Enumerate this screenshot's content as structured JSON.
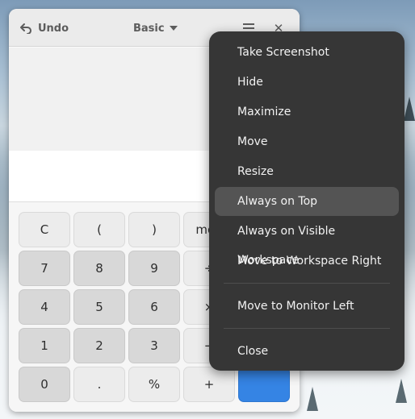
{
  "calculator": {
    "undo_label": "Undo",
    "mode_label": "Basic",
    "icons": {
      "undo": "undo-arrow-icon",
      "mode": "chevron-down-icon",
      "menu": "hamburger-menu-icon",
      "close": "close-icon"
    },
    "keypad": {
      "row1": [
        "C",
        "(",
        ")",
        "mod"
      ],
      "row2": [
        "7",
        "8",
        "9",
        "÷"
      ],
      "row3": [
        "4",
        "5",
        "6",
        "×"
      ],
      "row4": [
        "1",
        "2",
        "3",
        "−"
      ],
      "row5": [
        "0",
        ".",
        "%",
        "+"
      ]
    },
    "colors": {
      "accent": "#3584e4"
    }
  },
  "window_menu": {
    "items": [
      "Take Screenshot",
      "Hide",
      "Maximize",
      "Move",
      "Resize",
      "Always on Top",
      "Always on Visible Workspace",
      "Move to Workspace Right",
      "Move to Monitor Left",
      "Close"
    ],
    "highlighted": "Always on Top"
  }
}
